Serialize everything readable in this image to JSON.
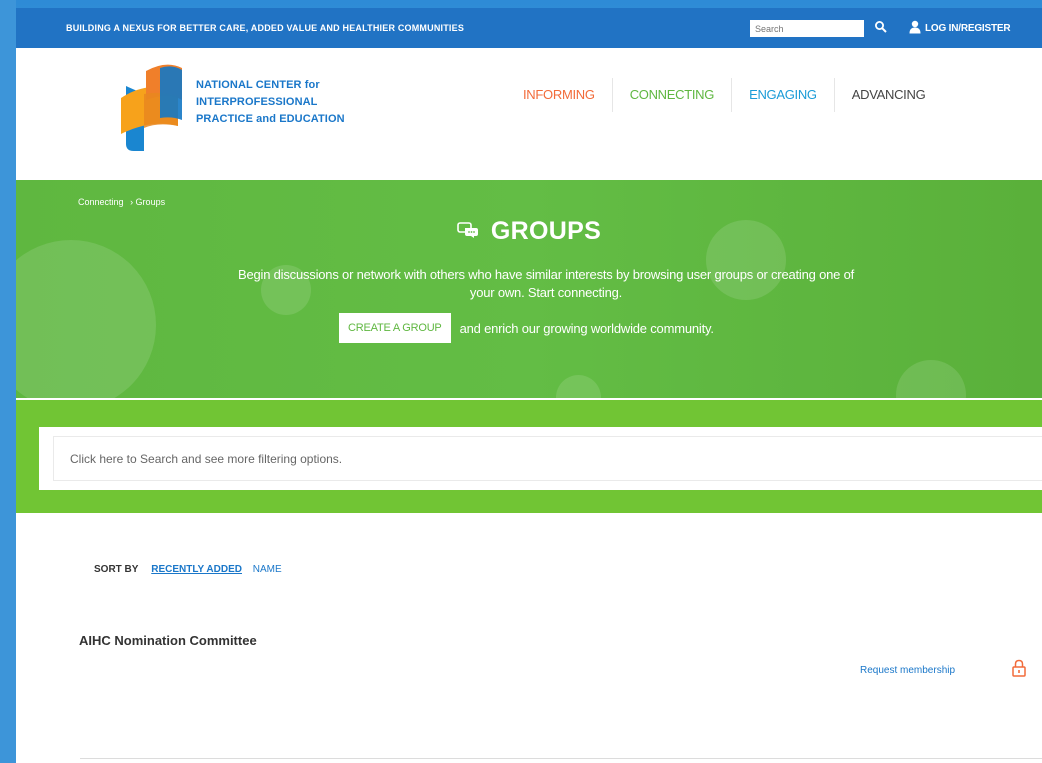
{
  "topbar": {
    "tagline": "BUILDING A NEXUS FOR BETTER CARE, ADDED VALUE AND HEALTHIER COMMUNITIES",
    "search_placeholder": "Search",
    "login_label": "LOG IN/REGISTER",
    "icons": [
      "search-icon",
      "user-icon"
    ]
  },
  "logo": {
    "lines": [
      "NATIONAL CENTER for",
      "INTERPROFESSIONAL",
      "PRACTICE and EDUCATION"
    ]
  },
  "nav": {
    "items": [
      {
        "label": "INFORMING",
        "color": "#f26b3a"
      },
      {
        "label": "CONNECTING",
        "color": "#5fb740"
      },
      {
        "label": "ENGAGING",
        "color": "#1a9bd7"
      },
      {
        "label": "ADVANCING",
        "color": "#444444"
      }
    ]
  },
  "hero": {
    "breadcrumb": [
      "Connecting",
      "› Groups"
    ],
    "title": "GROUPS",
    "description": "Begin discussions or network with others who have similar interests by browsing user groups or creating one of your own. Start connecting.",
    "create_button": "CREATE A GROUP",
    "create_suffix": "and enrich our growing worldwide community.",
    "icon": "chat-icon"
  },
  "search": {
    "prompt": "Click here to Search and see more filtering options."
  },
  "sort": {
    "label": "SORT BY",
    "options": [
      "RECENTLY ADDED",
      "NAME"
    ],
    "active": "RECENTLY ADDED"
  },
  "groups": [
    {
      "name": "AIHC Nomination Committee",
      "action": "Request membership",
      "icon": "lock-icon"
    }
  ],
  "colors": {
    "topbar": "#2173c4",
    "hero_green": "#5fb740",
    "band_green": "#71c534",
    "link_blue": "#1a77c9"
  }
}
